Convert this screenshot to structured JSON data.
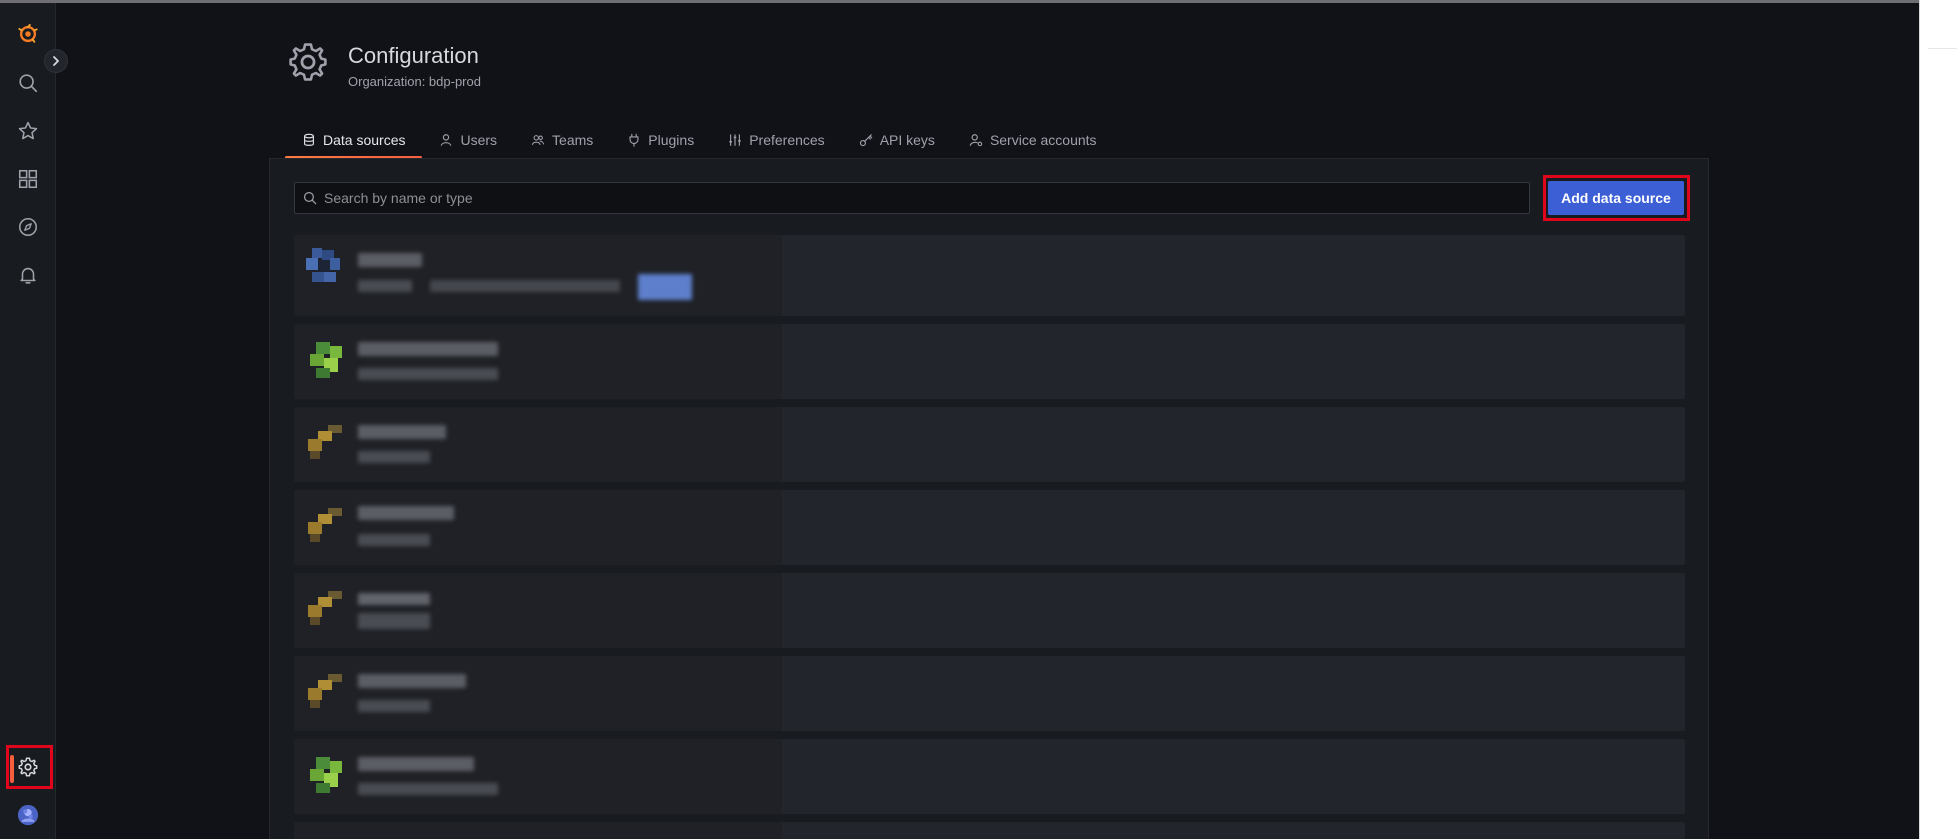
{
  "header": {
    "title": "Configuration",
    "subtitle": "Organization: bdp-prod"
  },
  "tabs": [
    {
      "label": "Data sources",
      "icon": "database-icon",
      "active": true
    },
    {
      "label": "Users",
      "icon": "user-icon",
      "active": false
    },
    {
      "label": "Teams",
      "icon": "users-icon",
      "active": false
    },
    {
      "label": "Plugins",
      "icon": "plug-icon",
      "active": false
    },
    {
      "label": "Preferences",
      "icon": "sliders-icon",
      "active": false
    },
    {
      "label": "API keys",
      "icon": "key-icon",
      "active": false
    },
    {
      "label": "Service accounts",
      "icon": "user-cog-icon",
      "active": false
    }
  ],
  "search": {
    "placeholder": "Search by name or type",
    "value": ""
  },
  "actions": {
    "add_label": "Add data source"
  },
  "sidebar": {
    "items": [
      "grafana-logo-icon",
      "search-icon",
      "star-icon",
      "dashboards-icon",
      "explore-icon",
      "bell-icon",
      "gear-icon",
      "avatar"
    ]
  },
  "colors": {
    "background": "#111217",
    "panel": "#181b1f",
    "card": "#22252b",
    "accent": "#f55f3e",
    "primary_button": "#3d5fd6",
    "annotation_red": "#e0051a"
  }
}
